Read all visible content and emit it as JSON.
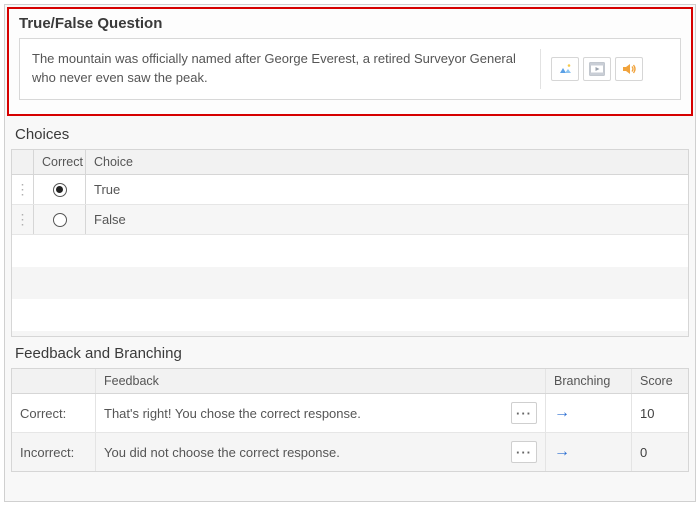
{
  "question_panel": {
    "title": "True/False Question",
    "text": "The mountain was officially named after George Everest, a retired Surveyor General who never even saw the peak."
  },
  "choices": {
    "section_title": "Choices",
    "header_correct": "Correct",
    "header_choice": "Choice",
    "rows": [
      {
        "label": "True",
        "correct": true
      },
      {
        "label": "False",
        "correct": false
      }
    ]
  },
  "feedback": {
    "section_title": "Feedback and Branching",
    "header_feedback": "Feedback",
    "header_branching": "Branching",
    "header_score": "Score",
    "rows": [
      {
        "label": "Correct:",
        "text": "That's right! You chose the correct response.",
        "score": "10"
      },
      {
        "label": "Incorrect:",
        "text": "You did not choose the correct response.",
        "score": "0"
      }
    ],
    "dots": "···",
    "arrow": "→"
  }
}
